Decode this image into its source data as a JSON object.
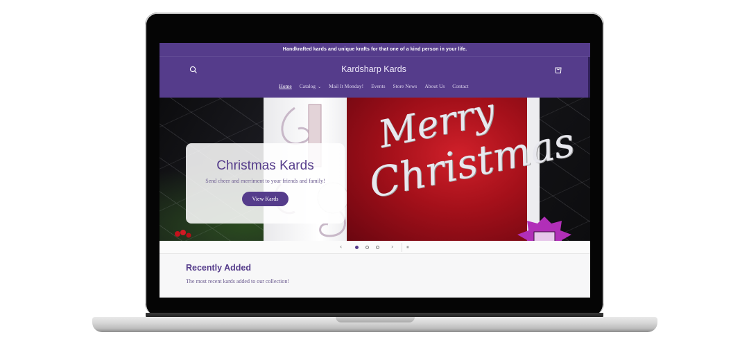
{
  "announcement": "Handkrafted kards and unique krafts for that one of a kind person in your life.",
  "header": {
    "site_title": "Kardsharp Kards",
    "nav": [
      "Home",
      "Catalog",
      "Mail It Monday!",
      "Events",
      "Store News",
      "About Us",
      "Contact"
    ],
    "active_nav": "Home"
  },
  "hero": {
    "title": "Christmas Kards",
    "subtitle": "Send cheer and merriment to your friends and family!",
    "button": "View Kards",
    "image_text_line1": "Merry",
    "image_text_line2": "Christmas"
  },
  "slider": {
    "prev": "‹",
    "next": "›",
    "pause": "⏸",
    "slide_count": 3,
    "active_slide": 1
  },
  "recent": {
    "title": "Recently Added",
    "subtitle": "The most recent kards added to our collection!"
  },
  "colors": {
    "brand_purple": "#553c8b",
    "card_red": "#c0141f"
  }
}
